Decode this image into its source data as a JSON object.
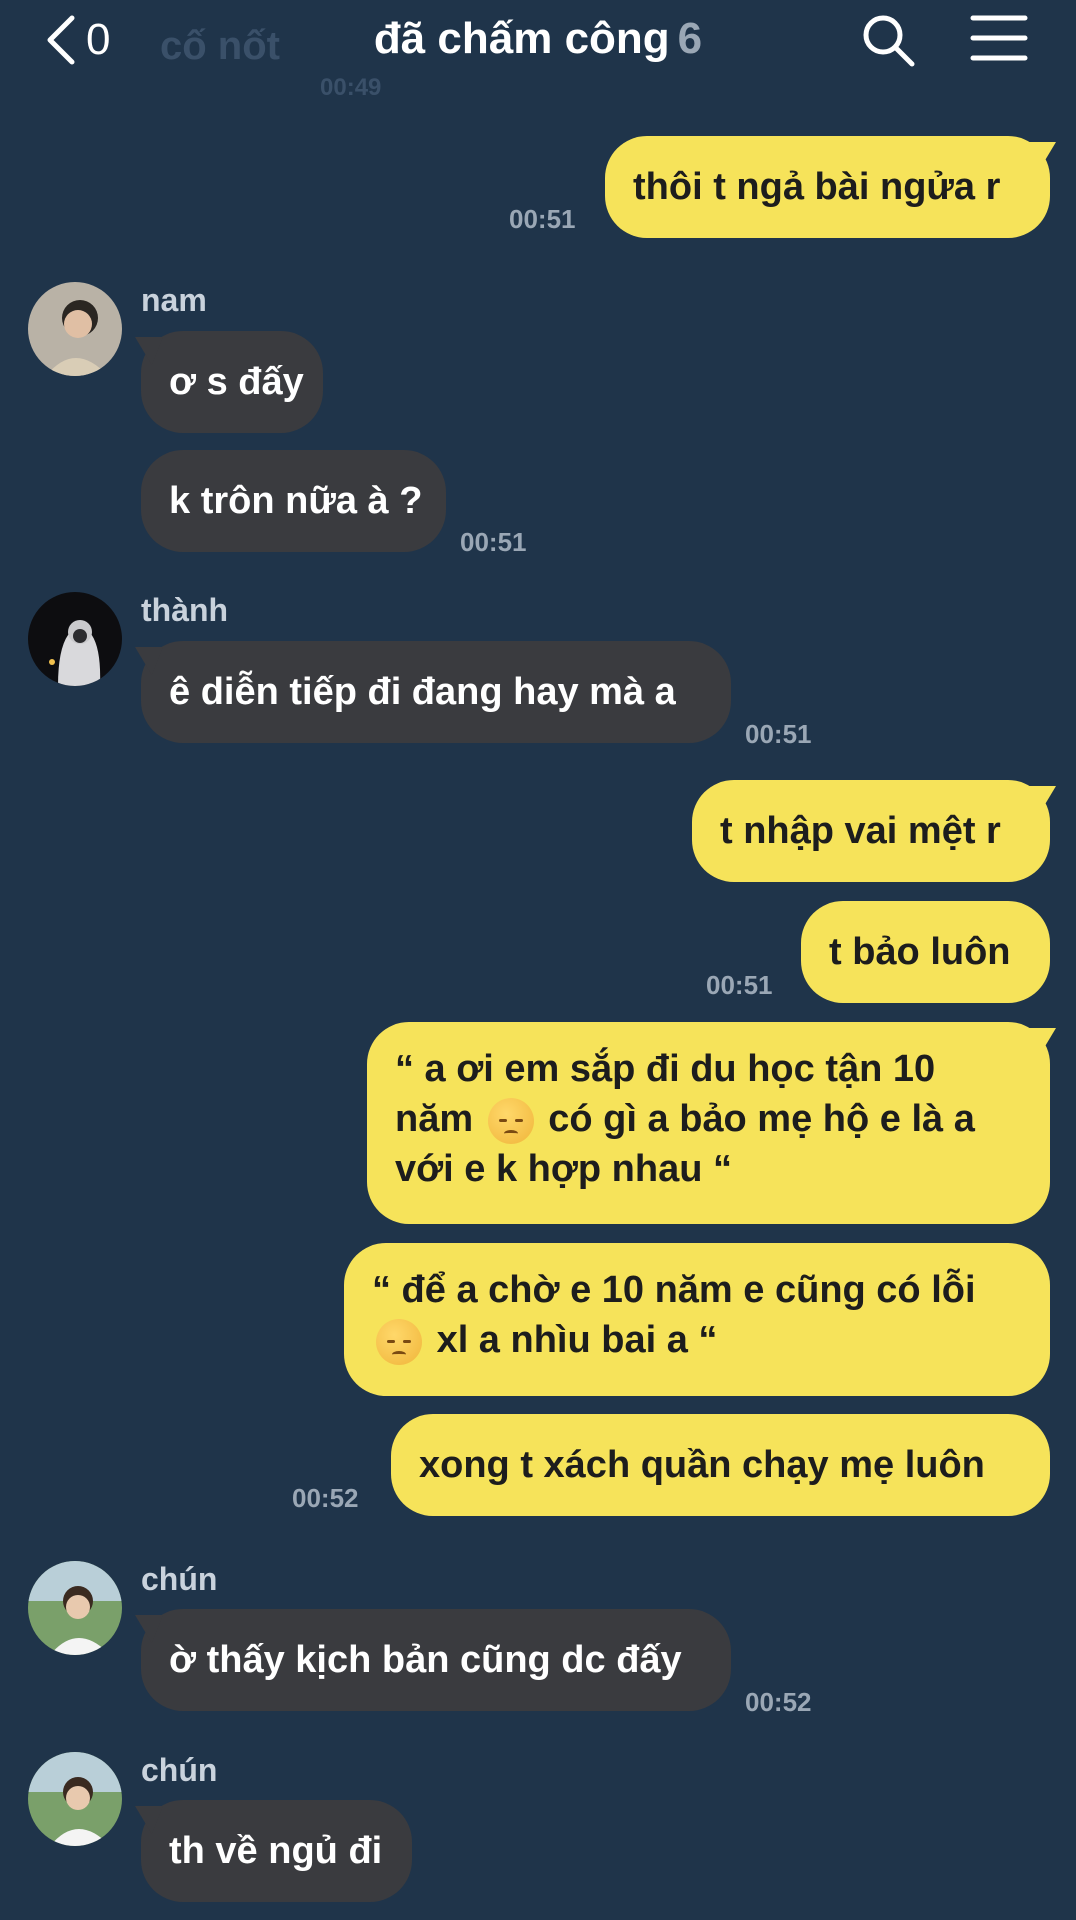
{
  "header": {
    "back_count": "0",
    "title": "đã chấm công",
    "member_count": "6",
    "ghost_text": "cố nốt",
    "ghost_time": "00:49"
  },
  "messages": [
    {
      "side": "out",
      "text": "thôi t ngả bài ngửa r",
      "time": "00:51"
    },
    {
      "side": "in",
      "sender": "nam",
      "text": "ơ s đấy"
    },
    {
      "side": "in",
      "text": "k trôn nữa à ?",
      "time": "00:51"
    },
    {
      "side": "in",
      "sender": "thành",
      "text": "ê diễn tiếp đi đang hay mà a",
      "time": "00:51"
    },
    {
      "side": "out",
      "text": "t nhập vai mệt r"
    },
    {
      "side": "out",
      "text": "t bảo luôn",
      "time": "00:51"
    },
    {
      "side": "out",
      "text_a": "“ a ơi em sắp đi du học tận 10 năm",
      "text_b": "có gì a bảo mẹ hộ e là a với e k hợp nhau “"
    },
    {
      "side": "out",
      "text_a": "“ để a chờ e 10 năm e cũng có lỗi",
      "text_b": "xl a nhìu bai a “"
    },
    {
      "side": "out",
      "text": "xong t xách quần chạy mẹ luôn",
      "time": "00:52"
    },
    {
      "side": "in",
      "sender": "chún",
      "text": "ờ thấy kịch bản cũng dc đấy",
      "time": "00:52"
    },
    {
      "side": "in",
      "sender": "chún",
      "text": "th về ngủ đi"
    }
  ],
  "icons": {
    "back": "chevron-left-icon",
    "search": "search-icon",
    "menu": "hamburger-menu-icon",
    "emoji": "pensive-face-emoji"
  },
  "colors": {
    "background": "#1f344a",
    "outgoing_bubble": "#f6e35a",
    "incoming_bubble": "#3a3b3f",
    "muted_text": "#9aa7b5"
  }
}
